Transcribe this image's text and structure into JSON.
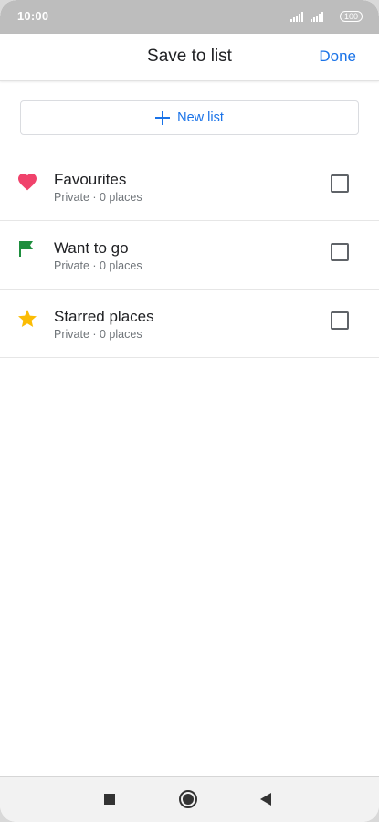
{
  "status_bar": {
    "time": "10:00",
    "battery": "100"
  },
  "header": {
    "title": "Save to list",
    "done_label": "Done"
  },
  "new_list": {
    "label": "New list"
  },
  "lists": [
    {
      "name": "Favourites",
      "subtitle": "Private · 0 places",
      "icon": "heart-icon",
      "icon_color": "#f0426b",
      "checked": false
    },
    {
      "name": "Want to go",
      "subtitle": "Private · 0 places",
      "icon": "flag-icon",
      "icon_color": "#1e8e3e",
      "checked": false
    },
    {
      "name": "Starred places",
      "subtitle": "Private · 0 places",
      "icon": "star-icon",
      "icon_color": "#fbbc04",
      "checked": false
    }
  ],
  "colors": {
    "accent": "#1a73e8",
    "status_bar": "#bdbdbd"
  },
  "nav": {
    "icons": [
      "recents-square-icon",
      "home-circle-icon",
      "back-triangle-icon"
    ]
  }
}
